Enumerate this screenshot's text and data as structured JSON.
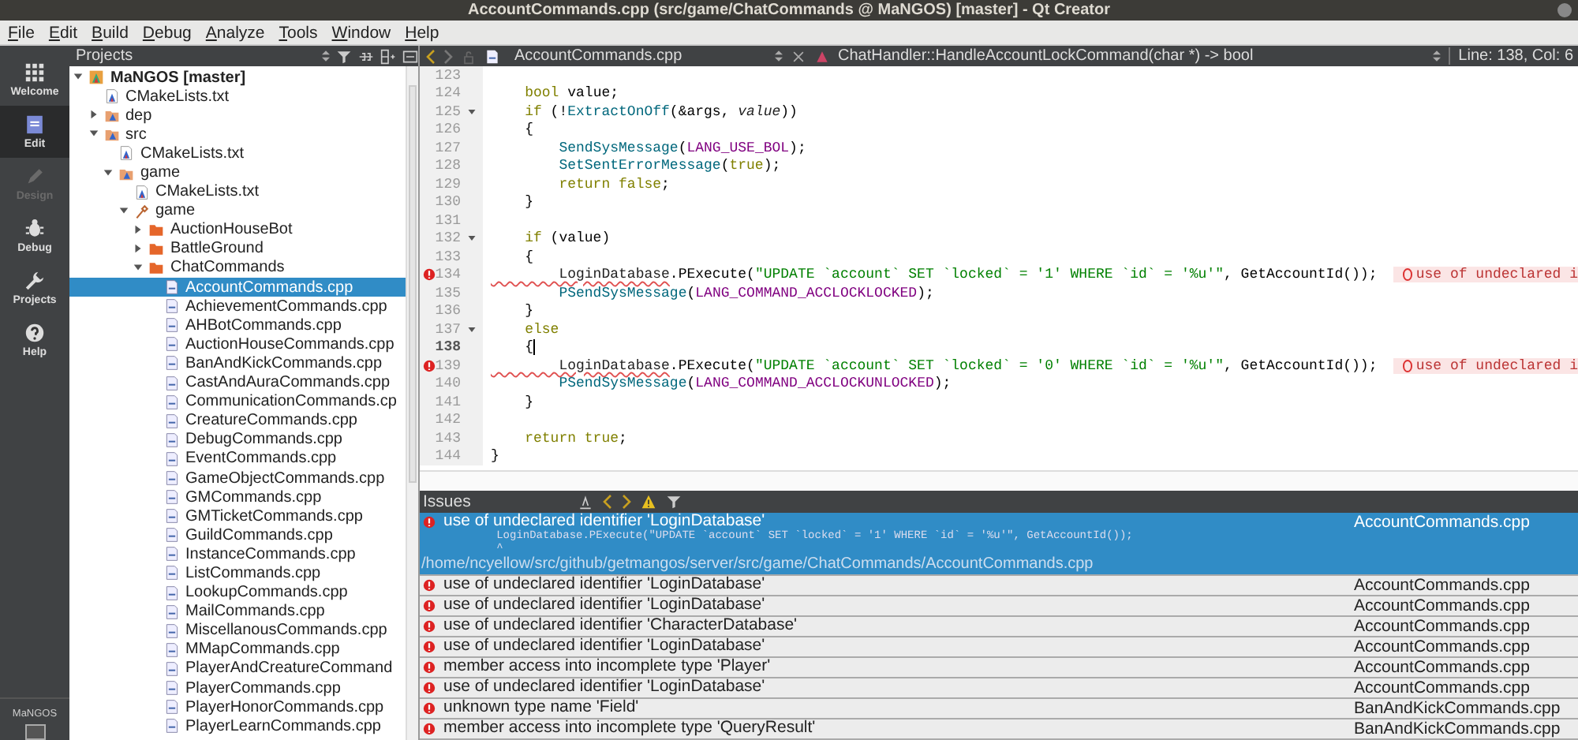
{
  "window": {
    "title": "AccountCommands.cpp (src/game/ChatCommands @ MaNGOS) [master] - Qt Creator"
  },
  "menu": [
    "File",
    "Edit",
    "Build",
    "Debug",
    "Analyze",
    "Tools",
    "Window",
    "Help"
  ],
  "modes": [
    {
      "label": "Welcome",
      "selected": false,
      "disabled": false,
      "kind": "grid"
    },
    {
      "label": "Edit",
      "selected": true,
      "disabled": false,
      "kind": "edit"
    },
    {
      "label": "Design",
      "selected": false,
      "disabled": true,
      "kind": "pen"
    },
    {
      "label": "Debug",
      "selected": false,
      "disabled": false,
      "kind": "bug"
    },
    {
      "label": "Projects",
      "selected": false,
      "disabled": false,
      "kind": "wrench"
    },
    {
      "label": "Help",
      "selected": false,
      "disabled": false,
      "kind": "help"
    }
  ],
  "kit": {
    "label": "MaNGOS"
  },
  "projects": {
    "title": "Projects",
    "tree": [
      {
        "label": "MaNGOS [master]",
        "kind": "project",
        "expanded": true,
        "selected": false,
        "children": [
          {
            "label": "CMakeLists.txt",
            "kind": "cmake",
            "selected": false
          },
          {
            "label": "dep",
            "kind": "cmakedir",
            "expanded": false,
            "selected": false
          },
          {
            "label": "src",
            "kind": "cmakedir",
            "expanded": true,
            "selected": false,
            "children": [
              {
                "label": "CMakeLists.txt",
                "kind": "cmake",
                "selected": false
              },
              {
                "label": "game",
                "kind": "cmakedir",
                "expanded": true,
                "selected": false,
                "children": [
                  {
                    "label": "CMakeLists.txt",
                    "kind": "cmake",
                    "selected": false
                  },
                  {
                    "label": "game",
                    "kind": "target",
                    "expanded": true,
                    "selected": false,
                    "children": [
                      {
                        "label": "AuctionHouseBot",
                        "kind": "folder",
                        "expanded": false,
                        "selected": false
                      },
                      {
                        "label": "BattleGround",
                        "kind": "folder",
                        "expanded": false,
                        "selected": false
                      },
                      {
                        "label": "ChatCommands",
                        "kind": "folder",
                        "expanded": true,
                        "selected": false,
                        "children": [
                          {
                            "label": "AccountCommands.cpp",
                            "kind": "cpp",
                            "selected": true
                          },
                          {
                            "label": "AchievementCommands.cpp",
                            "kind": "cpp",
                            "selected": false
                          },
                          {
                            "label": "AHBotCommands.cpp",
                            "kind": "cpp",
                            "selected": false
                          },
                          {
                            "label": "AuctionHouseCommands.cpp",
                            "kind": "cpp",
                            "selected": false
                          },
                          {
                            "label": "BanAndKickCommands.cpp",
                            "kind": "cpp",
                            "selected": false
                          },
                          {
                            "label": "CastAndAuraCommands.cpp",
                            "kind": "cpp",
                            "selected": false
                          },
                          {
                            "label": "CommunicationCommands.cp",
                            "kind": "cpp",
                            "selected": false
                          },
                          {
                            "label": "CreatureCommands.cpp",
                            "kind": "cpp",
                            "selected": false
                          },
                          {
                            "label": "DebugCommands.cpp",
                            "kind": "cpp",
                            "selected": false
                          },
                          {
                            "label": "EventCommands.cpp",
                            "kind": "cpp",
                            "selected": false
                          },
                          {
                            "label": "GameObjectCommands.cpp",
                            "kind": "cpp",
                            "selected": false
                          },
                          {
                            "label": "GMCommands.cpp",
                            "kind": "cpp",
                            "selected": false
                          },
                          {
                            "label": "GMTicketCommands.cpp",
                            "kind": "cpp",
                            "selected": false
                          },
                          {
                            "label": "GuildCommands.cpp",
                            "kind": "cpp",
                            "selected": false
                          },
                          {
                            "label": "InstanceCommands.cpp",
                            "kind": "cpp",
                            "selected": false
                          },
                          {
                            "label": "ListCommands.cpp",
                            "kind": "cpp",
                            "selected": false
                          },
                          {
                            "label": "LookupCommands.cpp",
                            "kind": "cpp",
                            "selected": false
                          },
                          {
                            "label": "MailCommands.cpp",
                            "kind": "cpp",
                            "selected": false
                          },
                          {
                            "label": "MiscellanousCommands.cpp",
                            "kind": "cpp",
                            "selected": false
                          },
                          {
                            "label": "MMapCommands.cpp",
                            "kind": "cpp",
                            "selected": false
                          },
                          {
                            "label": "PlayerAndCreatureCommand",
                            "kind": "cpp",
                            "selected": false
                          },
                          {
                            "label": "PlayerCommands.cpp",
                            "kind": "cpp",
                            "selected": false
                          },
                          {
                            "label": "PlayerHonorCommands.cpp",
                            "kind": "cpp",
                            "selected": false
                          },
                          {
                            "label": "PlayerLearnCommands.cpp",
                            "kind": "cpp",
                            "selected": false
                          }
                        ]
                      }
                    ]
                  }
                ]
              }
            ]
          }
        ]
      }
    ]
  },
  "editor": {
    "file": "AccountCommands.cpp",
    "symbol": "ChatHandler::HandleAccountLockCommand(char *) -> bool",
    "position": "Line: 138, Col: 6",
    "lines": [
      {
        "number": "123"
      },
      {
        "number": "124",
        "tokens": [
          {
            "kind": "kw",
            "text": "    bool"
          },
          {
            "kind": "plain",
            "text": " value;"
          }
        ]
      },
      {
        "number": "125",
        "foldable": true,
        "tokens": [
          {
            "kind": "kw",
            "text": "    if"
          },
          {
            "kind": "plain",
            "text": " (!"
          },
          {
            "kind": "fn",
            "text": "ExtractOnOff"
          },
          {
            "kind": "plain",
            "text": "(&args, "
          },
          {
            "kind": "param",
            "text": "value"
          },
          {
            "kind": "plain",
            "text": "))"
          }
        ]
      },
      {
        "number": "126",
        "tokens": [
          {
            "kind": "plain",
            "text": "    {"
          }
        ]
      },
      {
        "number": "127",
        "tokens": [
          {
            "kind": "fn",
            "text": "        SendSysMessage"
          },
          {
            "kind": "plain",
            "text": "("
          },
          {
            "kind": "macro",
            "text": "LANG_USE_BOL"
          },
          {
            "kind": "plain",
            "text": ");"
          }
        ]
      },
      {
        "number": "128",
        "tokens": [
          {
            "kind": "fn",
            "text": "        SetSentErrorMessage"
          },
          {
            "kind": "plain",
            "text": "("
          },
          {
            "kind": "kw",
            "text": "true"
          },
          {
            "kind": "plain",
            "text": ");"
          }
        ]
      },
      {
        "number": "129",
        "tokens": [
          {
            "kind": "kw",
            "text": "        return false"
          },
          {
            "kind": "plain",
            "text": ";"
          }
        ]
      },
      {
        "number": "130",
        "tokens": [
          {
            "kind": "plain",
            "text": "    }"
          }
        ]
      },
      {
        "number": "131"
      },
      {
        "number": "132",
        "foldable": true,
        "tokens": [
          {
            "kind": "kw",
            "text": "    if"
          },
          {
            "kind": "plain",
            "text": " (value)"
          }
        ]
      },
      {
        "number": "133",
        "tokens": [
          {
            "kind": "plain",
            "text": "    {"
          }
        ]
      },
      {
        "number": "134",
        "error": true,
        "annotation": "use of undeclared i",
        "tokens": [
          {
            "kind": "err",
            "text": "        LoginDatabase"
          },
          {
            "kind": "plain",
            "text": ".PExecute("
          },
          {
            "kind": "str",
            "text": "\"UPDATE `account` SET `locked` = '1' WHERE `id` = '%u'\""
          },
          {
            "kind": "plain",
            "text": ", GetAccountId());"
          }
        ]
      },
      {
        "number": "135",
        "tokens": [
          {
            "kind": "fn",
            "text": "        PSendSysMessage"
          },
          {
            "kind": "plain",
            "text": "("
          },
          {
            "kind": "macro",
            "text": "LANG_COMMAND_ACCLOCKLOCKED"
          },
          {
            "kind": "plain",
            "text": ");"
          }
        ]
      },
      {
        "number": "136",
        "tokens": [
          {
            "kind": "plain",
            "text": "    }"
          }
        ]
      },
      {
        "number": "137",
        "foldable": true,
        "tokens": [
          {
            "kind": "kw",
            "text": "    else"
          }
        ]
      },
      {
        "number": "138",
        "current": true,
        "tokens": [
          {
            "kind": "plain",
            "text": "    {"
          }
        ]
      },
      {
        "number": "139",
        "error": true,
        "annotation": "use of undeclared i",
        "tokens": [
          {
            "kind": "err",
            "text": "        LoginDatabase"
          },
          {
            "kind": "plain",
            "text": ".PExecute("
          },
          {
            "kind": "str",
            "text": "\"UPDATE `account` SET `locked` = '0' WHERE `id` = '%u'\""
          },
          {
            "kind": "plain",
            "text": ", GetAccountId());"
          }
        ]
      },
      {
        "number": "140",
        "tokens": [
          {
            "kind": "fn",
            "text": "        PSendSysMessage"
          },
          {
            "kind": "plain",
            "text": "("
          },
          {
            "kind": "macro",
            "text": "LANG_COMMAND_ACCLOCKUNLOCKED"
          },
          {
            "kind": "plain",
            "text": ");"
          }
        ]
      },
      {
        "number": "141",
        "tokens": [
          {
            "kind": "plain",
            "text": "    }"
          }
        ]
      },
      {
        "number": "142"
      },
      {
        "number": "143",
        "tokens": [
          {
            "kind": "kw",
            "text": "    return true"
          },
          {
            "kind": "plain",
            "text": ";"
          }
        ]
      },
      {
        "number": "144",
        "tokens": [
          {
            "kind": "plain",
            "text": "}"
          }
        ]
      }
    ]
  },
  "issues": {
    "title": "Issues",
    "rows": [
      {
        "selected": true,
        "description": "use of undeclared identifier 'LoginDatabase'",
        "file": "AccountCommands.cpp",
        "details": [
          "        LoginDatabase.PExecute(\"UPDATE `account` SET `locked` = '1' WHERE `id` = '%u'\", GetAccountId());",
          "        ^"
        ],
        "path": "/home/ncyellow/src/github/getmangos/server/src/game/ChatCommands/AccountCommands.cpp"
      },
      {
        "selected": false,
        "description": "use of undeclared identifier 'LoginDatabase'",
        "file": "AccountCommands.cpp"
      },
      {
        "selected": false,
        "description": "use of undeclared identifier 'LoginDatabase'",
        "file": "AccountCommands.cpp"
      },
      {
        "selected": false,
        "description": "use of undeclared identifier 'CharacterDatabase'",
        "file": "AccountCommands.cpp"
      },
      {
        "selected": false,
        "description": "use of undeclared identifier 'LoginDatabase'",
        "file": "AccountCommands.cpp"
      },
      {
        "selected": false,
        "description": "member access into incomplete type 'Player'",
        "file": "AccountCommands.cpp"
      },
      {
        "selected": false,
        "description": "use of undeclared identifier 'LoginDatabase'",
        "file": "AccountCommands.cpp"
      },
      {
        "selected": false,
        "description": "unknown type name 'Field'",
        "file": "BanAndKickCommands.cpp"
      },
      {
        "selected": false,
        "description": "member access into incomplete type 'QueryResult'",
        "file": "BanAndKickCommands.cpp"
      }
    ]
  }
}
